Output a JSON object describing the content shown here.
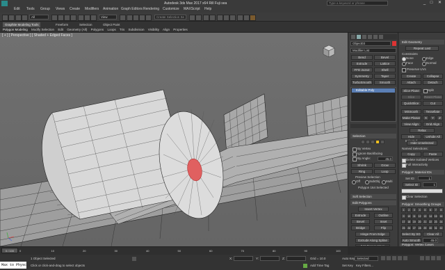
{
  "window": {
    "title": "Autodesk 3ds Max 2017 x64    Rill Fuji sea",
    "search_placeholder": "Type a keyword or phrase"
  },
  "menu": [
    "Edit",
    "Tools",
    "Group",
    "Views",
    "Create",
    "Modifiers",
    "Animation",
    "Graph Editors",
    "Rendering",
    "Customize",
    "MAXScript",
    "Help"
  ],
  "toolbar": {
    "selection_filter": "All",
    "view_label": "View",
    "create_set": "Create Selection Se"
  },
  "ribbon": {
    "tabs": [
      "Graphite Modeling Tools",
      "Freeform",
      "Selection",
      "Object Paint"
    ],
    "sub": [
      "Polygon Modeling",
      "Modify Selection",
      "Edit",
      "Geometry (All)",
      "Polygons",
      "Loops",
      "Tris",
      "Subdivision",
      "Visibility",
      "Align",
      "Properties"
    ]
  },
  "viewport": {
    "label": "[ + ] [ Perspective ] [ Shaded + Edged Faces ]"
  },
  "mid_panel": {
    "object_name": "Object03",
    "modifier_list": "Modifier List",
    "modifier_buttons": [
      "Bend",
      "Bevel",
      "Extrude",
      "Lattice",
      "FFD 2x2x2",
      "Shell",
      "Symmetry",
      "Taper",
      "TurboSmooth",
      "Smooth"
    ],
    "stack_item": "Editable Poly",
    "selection_header": "Selection",
    "by_vertex": "By Vertex",
    "ignore_backfacing": "Ignore Backfacing",
    "by_angle": "By Angle:",
    "by_angle_value": "45.0",
    "shrink": "Shrink",
    "grow": "Grow",
    "ring": "Ring",
    "loop": "Loop",
    "preview_selection": "Preview Selection",
    "preview_off": "Off",
    "preview_subobj": "SubObj",
    "preview_multi": "Multi",
    "selected_count": "Polygon 164 Selected",
    "soft_selection": "Soft Selection",
    "edit_polygons": "Edit Polygons",
    "insert_vertex": "Insert Vertex",
    "extrude": "Extrude",
    "outline": "Outline",
    "bevel": "Bevel",
    "inset": "Inset",
    "bridge": "Bridge",
    "flip": "Flip",
    "hinge": "Hinge From Edge",
    "extrude_spline": "Extrude Along Spline",
    "edit_triangulation": "Edit Triangulation",
    "retriangulate": "Retriangulate",
    "turn": "Turn"
  },
  "right_panel": {
    "edit_geometry": "Edit Geometry",
    "repeat_last": "Repeat Last",
    "constraints": "Constraints",
    "c_none": "None",
    "c_edge": "Edge",
    "c_face": "Face",
    "c_normal": "Normal",
    "preserve_uvs": "Preserve UVs",
    "create": "Create",
    "collapse": "Collapse",
    "attach": "Attach",
    "detach": "Detach",
    "slice_plane": "Slice Plane",
    "split": "Split",
    "slice": "Slice",
    "reset_plane": "Reset Plane",
    "quickslice": "QuickSlice",
    "cut": "Cut",
    "msmooth": "MSmooth",
    "tessellate": "Tessellate",
    "make_planar": "Make Planar",
    "x": "X",
    "y": "Y",
    "z": "Z",
    "view_align": "View Align",
    "grid_align": "Grid Align",
    "relax": "Relax",
    "hide_selected": "Hide Selected",
    "unhide_all": "Unhide All",
    "hide_unselected": "Hide Unselected",
    "named_selections": "Named Selections:",
    "copy": "Copy",
    "paste": "Paste",
    "delete_isolated": "Delete Isolated Vertices",
    "full_interactivity": "Full Interactivity",
    "material_ids": "Polygon: Material IDs",
    "set_id": "Set ID:",
    "set_id_value": "1",
    "select_id": "Select ID",
    "select_id_value": "1",
    "clear_selection": "Clear Selection",
    "smoothing_groups": "Polygon: Smoothing Groups",
    "sg_numbers": [
      "1",
      "2",
      "3",
      "4",
      "5",
      "6",
      "7",
      "8",
      "9",
      "10",
      "11",
      "12",
      "13",
      "14",
      "15",
      "16",
      "17",
      "18",
      "19",
      "20",
      "21",
      "22",
      "23",
      "24",
      "25",
      "26",
      "27",
      "28",
      "29",
      "30",
      "31",
      "32"
    ],
    "select_by_sg": "Select By SG",
    "clear_all": "Clear All",
    "auto_smooth": "Auto Smooth",
    "auto_smooth_value": "45.0",
    "vertex_colors": "Polygon: Vertex Colors",
    "color": "Color:"
  },
  "timeline": {
    "start": "0",
    "marker": "0 / 100",
    "ticks": [
      "0",
      "10",
      "20",
      "30",
      "40",
      "50",
      "60",
      "70",
      "80",
      "90",
      "100"
    ]
  },
  "status": {
    "script_label": "Max to Physc",
    "objects_selected": "1 Object Selected",
    "prompt": "Click or click-and-drag to select objects",
    "x_label": "X:",
    "y_label": "Y:",
    "z_label": "Z:",
    "grid": "Grid = 10.0",
    "add_time_tag": "Add Time Tag",
    "auto_key": "Auto Key",
    "selected": "Selected",
    "set_key": "Set Key",
    "key_filters": "Key Filters..."
  }
}
